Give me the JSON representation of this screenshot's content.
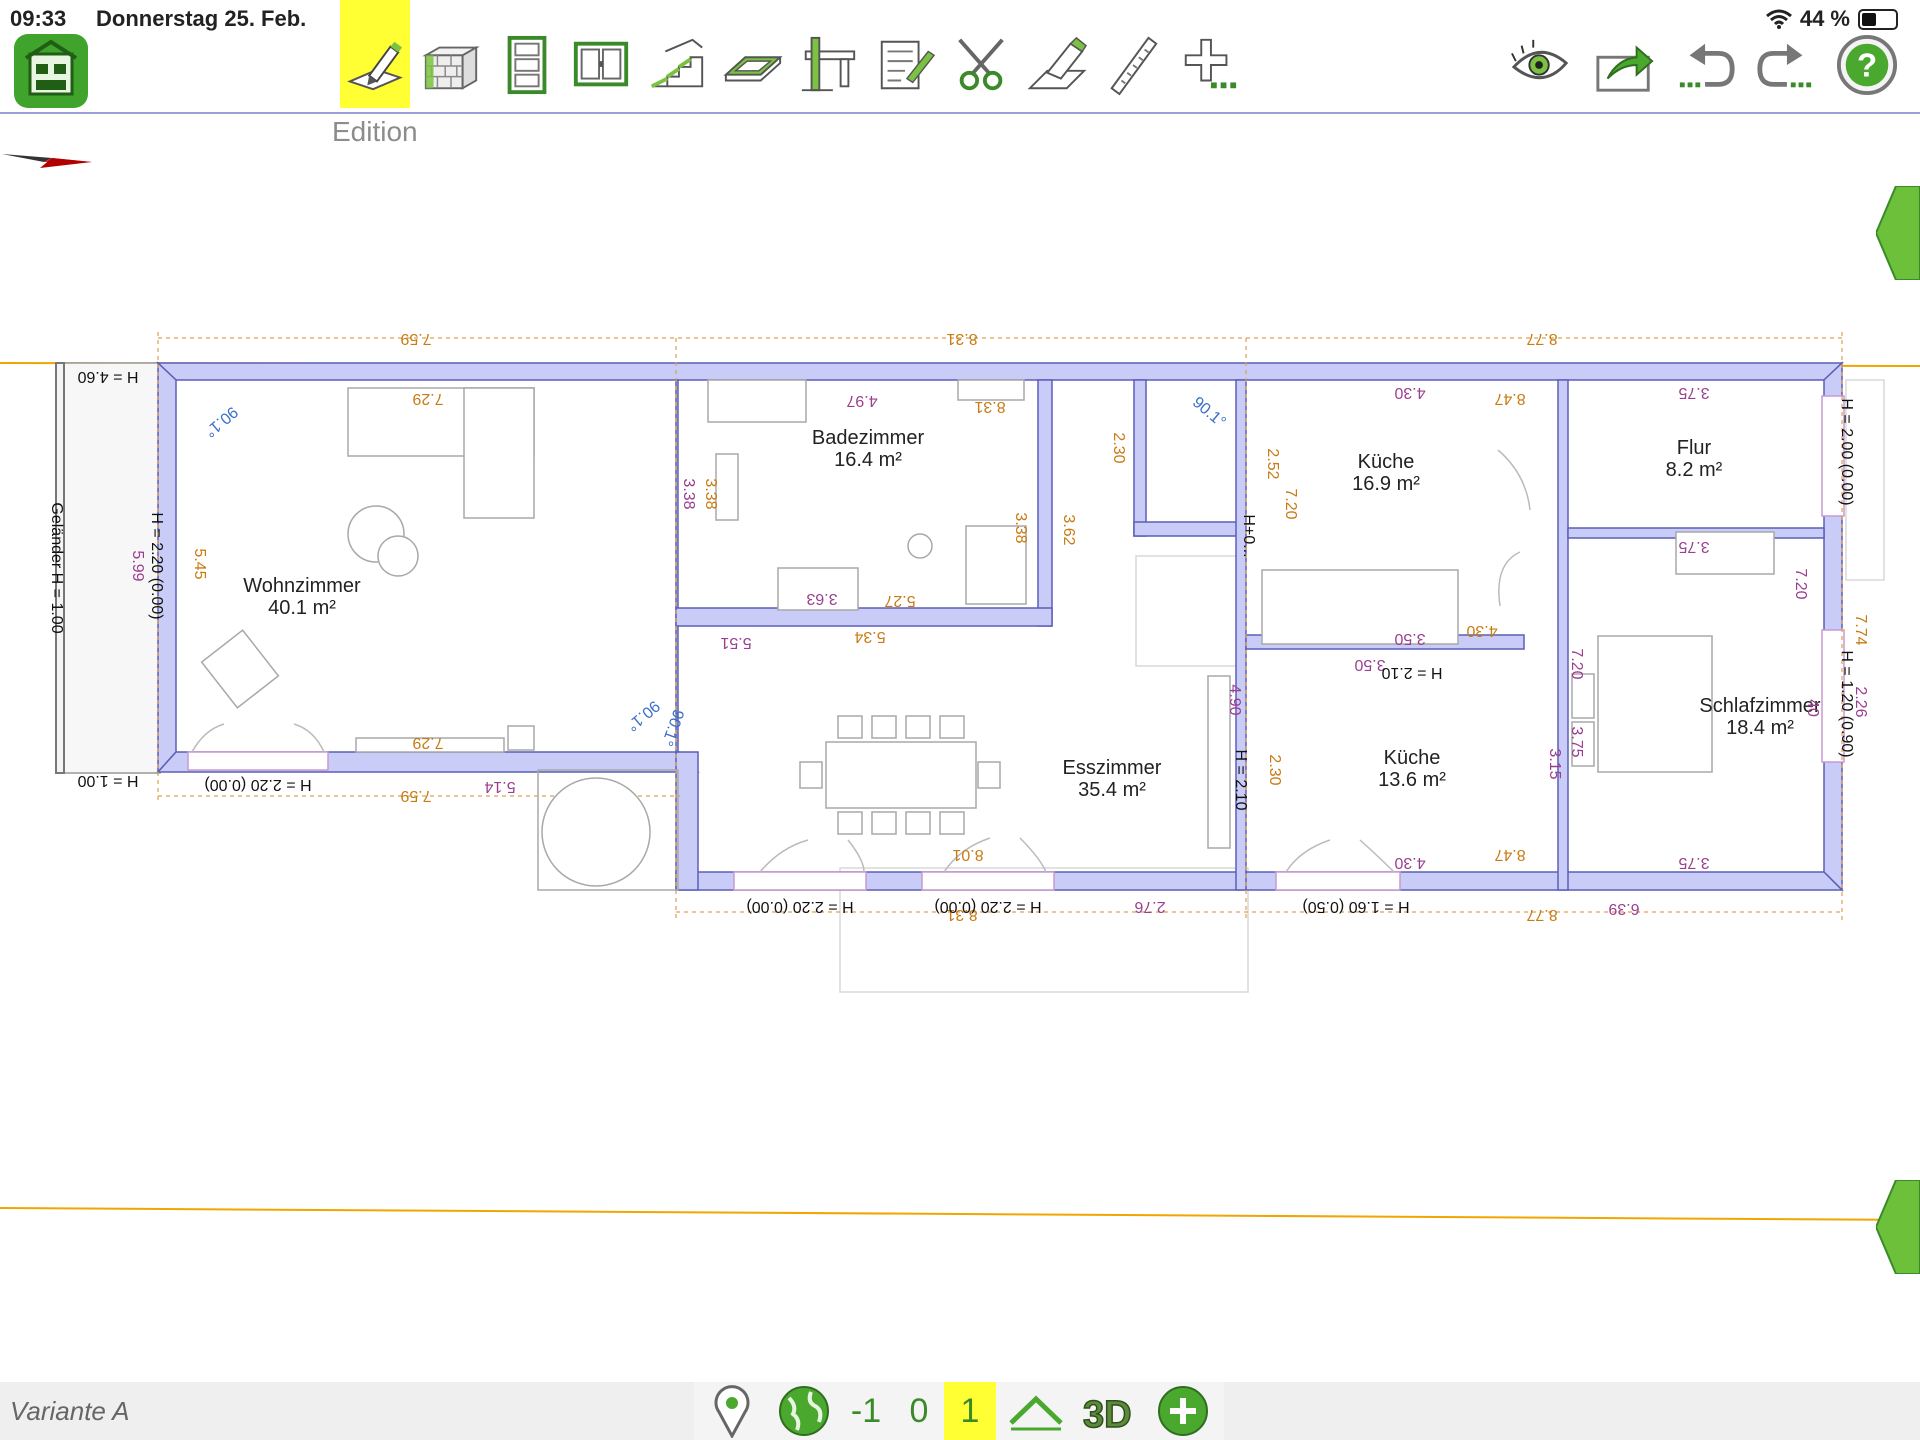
{
  "status": {
    "time": "09:33",
    "date": "Donnerstag 25. Feb.",
    "battery": "44 %",
    "battery_level": 0.44
  },
  "toolbar": {
    "tool_label": "Edition",
    "tools": [
      "edit-pencil-icon",
      "wall-icon",
      "door-icon",
      "window-icon",
      "stairs-icon",
      "slab-icon",
      "beam-icon",
      "note-icon",
      "cut-icon",
      "erase-icon",
      "measure-icon",
      "add-more-icon"
    ],
    "right_tools": [
      "visibility-eye-icon",
      "share-icon",
      "undo-icon",
      "redo-icon",
      "help-icon"
    ],
    "help_glyph": "?"
  },
  "plan": {
    "rooms": [
      {
        "name": "Wohnzimmer",
        "area": "40.1 m²"
      },
      {
        "name": "Badezimmer",
        "area": "16.4 m²"
      },
      {
        "name": "Küche",
        "area": "16.9 m²"
      },
      {
        "name": "Flur",
        "area": "8.2 m²"
      },
      {
        "name": "Schlafzimmer",
        "area": "18.4 m²"
      },
      {
        "name": "Küche",
        "area": "13.6 m²"
      },
      {
        "name": "Esszimmer",
        "area": "35.4 m²"
      }
    ],
    "labels": {
      "top_dims": [
        "7.59",
        "8.31",
        "8.77"
      ],
      "bottom_dims": [
        "7.59",
        "8.31",
        "8.77",
        "6.39",
        "2.76",
        "5.14"
      ],
      "railing": "Geländer H = 1.00",
      "h_460": "H = 4.60",
      "h_100": "H = 1.00",
      "h_220_left": "H = 2.20 (0.00)",
      "h_220_a": "H = 2.20 (0.00)",
      "h_220_b": "H = 2.20 (0.00)",
      "h_160": "H = 1.60 (0.50)",
      "h_200": "H = 2.00 (0.00)",
      "h_120": "H = 1.20 (0.90)",
      "h_210": "H = 2.10",
      "h_210b": "H = 2.10",
      "wz_inner_top": "7.29",
      "wz_inner_bot": "7.29",
      "wz_545": "5.45",
      "wz_599": "5.99",
      "wz_h220": "H = 2.20 (0.00)",
      "bad_497": "4.97",
      "bad_831": "8.31",
      "bad_338a": "3.38",
      "bad_338b": "3.38",
      "bad_338c": "3.38",
      "bad_363": "3.63",
      "bad_527": "5.27",
      "bad_230": "2.30",
      "bad_362": "3.62",
      "ess_551": "5.51",
      "ess_534": "5.34",
      "ess_801": "8.01",
      "k_430a": "4.30",
      "k_847a": "8.47",
      "k_252": "2.52",
      "k_720a": "7.20",
      "k_350a": "3.50",
      "k_350b": "3.50",
      "k_430b": "4.30",
      "k_490": "4.90",
      "k_230": "2.30",
      "k_430c": "4.30",
      "k_847b": "8.47",
      "k_315": "3.15",
      "f_375a": "3.75",
      "f_375b": "3.75",
      "f_720": "7.20",
      "s_720": "7.20",
      "s_375a": "3.75",
      "s_375b": "3.75",
      "s_774": "7.74",
      "s_226": "2.26",
      "s_40": "40",
      "angle_a": "90.1°",
      "angle_b": "90.1°",
      "angle_c": "90.1°",
      "angle_d": "90.1°",
      "h_short": "H+0..."
    }
  },
  "bottom": {
    "variant": "Variante A",
    "levels": [
      "-1",
      "0",
      "1"
    ],
    "active_level": "1",
    "icons": [
      "location-pin-icon",
      "globe-icon",
      "roof-icon",
      "3d-view-icon",
      "add-level-icon"
    ],
    "three_d_label": "3D"
  },
  "colors": {
    "accent_green": "#4aa82f",
    "highlight": "#ffff33",
    "wall": "#c9ccf7",
    "dim_orange": "#c87b12",
    "dim_purple": "#9a3f8e"
  }
}
